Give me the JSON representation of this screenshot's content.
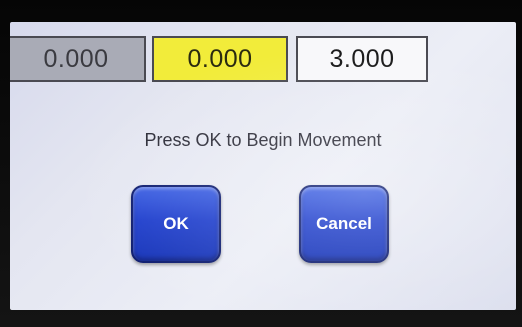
{
  "readouts": {
    "value_1": "0.000",
    "value_2": "0.000",
    "value_3": "3.000"
  },
  "dialog": {
    "message": "Press OK to Begin Movement",
    "ok_label": "OK",
    "cancel_label": "Cancel"
  },
  "colors": {
    "field_1_bg": "#a9abb6",
    "field_2_bg": "#f2ec3a",
    "field_3_bg": "#f8f8fa",
    "button_bg": "#1c3ccc"
  }
}
